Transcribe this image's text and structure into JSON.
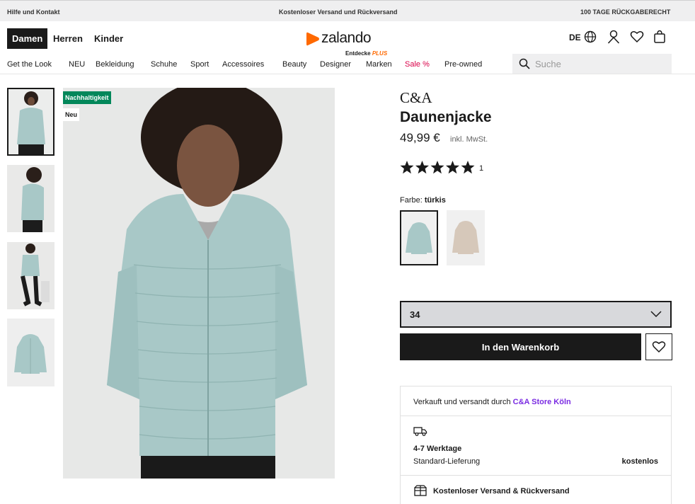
{
  "topbar": {
    "help": "Hilfe und Kontakt",
    "shipping": "Kostenloser Versand und Rückversand",
    "returns": "100 TAGE RÜCKGABERECHT"
  },
  "header": {
    "gender_tabs": [
      "Damen",
      "Herren",
      "Kinder"
    ],
    "logo_text": "zalando",
    "logo_sub": "Entdecke",
    "logo_plus": "PLUS",
    "language": "DE"
  },
  "nav": {
    "items": [
      "Get the Look",
      "NEU",
      "Bekleidung",
      "Schuhe",
      "Sport",
      "Accessoires",
      "Beauty",
      "Designer",
      "Marken",
      "Sale %",
      "Pre-owned"
    ],
    "search_placeholder": "Suche"
  },
  "gallery": {
    "badge_sustainability": "Nachhaltigkeit",
    "badge_new": "Neu"
  },
  "product": {
    "brand": "C&A",
    "name": "Daunenjacke",
    "price": "49,99 €",
    "vat_note": "inkl. MwSt.",
    "rating": 5,
    "rating_count": "1",
    "color_label": "Farbe:",
    "color_value": "türkis",
    "size_selected": "34",
    "add_to_cart": "In den Warenkorb"
  },
  "seller": {
    "sold_by": "Verkauft und versandt durch",
    "store": "C&A Store Köln",
    "delivery_time": "4-7 Werktage",
    "delivery_type": "Standard-Lieferung",
    "delivery_price": "kostenlos",
    "free_shipping": "Kostenloser Versand & Rückversand"
  },
  "colors": {
    "accent_green": "#03875a",
    "sale_red": "#d90048",
    "store_link": "#7a2be2",
    "logo_orange": "#ff6900",
    "jacket_turquoise": "#a8c8c7"
  }
}
